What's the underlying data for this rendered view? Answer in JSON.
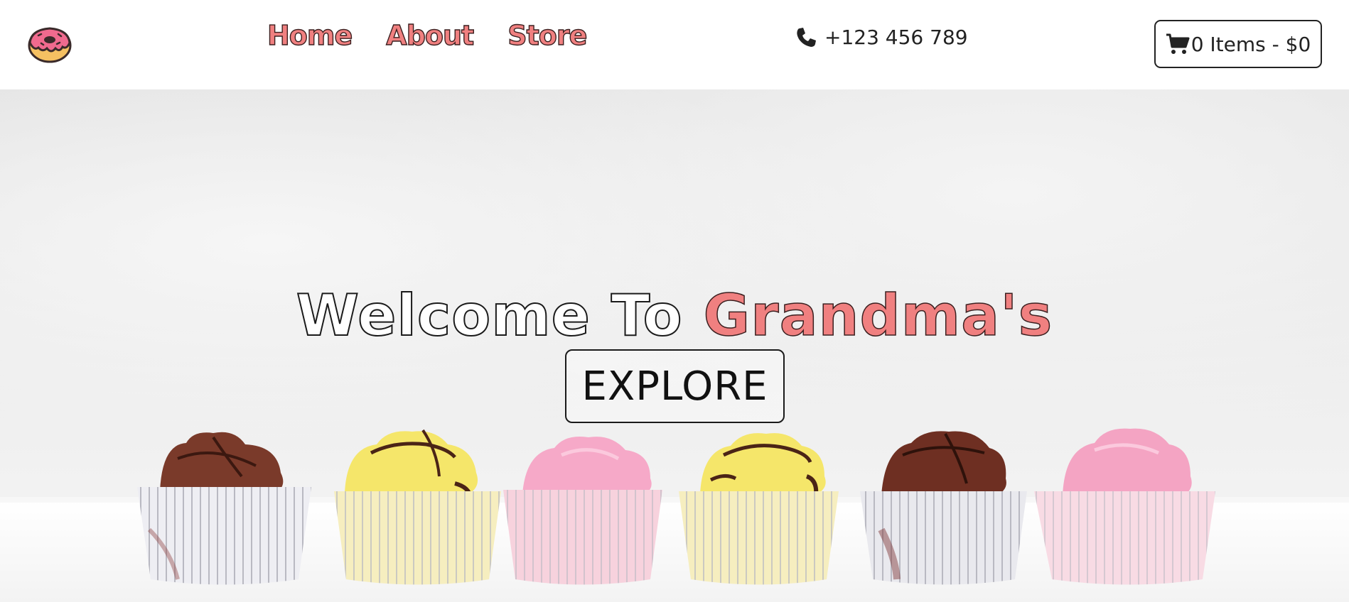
{
  "brand": {
    "logo_icon": "donut-icon"
  },
  "nav": {
    "links": [
      {
        "label": "Home"
      },
      {
        "label": "About"
      },
      {
        "label": "Store"
      }
    ]
  },
  "contact": {
    "phone_icon": "phone-icon",
    "phone": "+123 456 789"
  },
  "cart": {
    "icon": "shopping-cart-icon",
    "label": "0 Items - $0"
  },
  "hero": {
    "title_part_a": "Welcome To ",
    "title_part_b": "Grandma's",
    "button_label": "EXPLORE",
    "background": "cupcakes-photo"
  },
  "colors": {
    "accent_pink": "#f08080",
    "text_dark": "#222222",
    "outline_dark": "#3a1f1f",
    "white": "#ffffff"
  }
}
